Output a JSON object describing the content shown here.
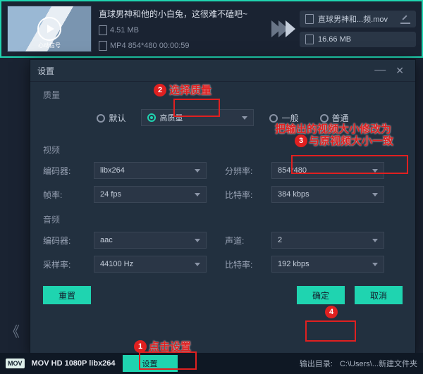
{
  "topbar": {
    "source_title": "直球男神和他的小白兔，这很难不磕吧~",
    "thumb_sub": "心动信号",
    "source_size": "4.51 MB",
    "source_format": "MP4 854*480 00:00:59",
    "output_name": "直球男神和...频.mov",
    "output_size": "16.66 MB"
  },
  "dialog": {
    "title": "设置",
    "sec_quality": "质量",
    "quality": {
      "default": "默认",
      "high": "高质量",
      "medium": "一般",
      "normal": "普通"
    },
    "sec_video": "视频",
    "video": {
      "encoder_lbl": "编码器:",
      "encoder_val": "libx264",
      "res_lbl": "分辨率:",
      "res_val": "854*480",
      "fps_lbl": "帧率:",
      "fps_val": "24 fps",
      "bitrate_lbl": "比特率:",
      "bitrate_val": "384 kbps"
    },
    "sec_audio": "音频",
    "audio": {
      "encoder_lbl": "编码器:",
      "encoder_val": "aac",
      "channel_lbl": "声道:",
      "channel_val": "2",
      "sample_lbl": "采样率:",
      "sample_val": "44100 Hz",
      "bitrate_lbl": "比特率:",
      "bitrate_val": "192 kbps"
    },
    "reset": "重置",
    "ok": "确定",
    "cancel": "取消"
  },
  "bottom": {
    "badge": "MOV",
    "format": "MOV HD 1080P libx264",
    "settings": "设置",
    "outdir_lbl": "输出目录:",
    "outdir": "C:\\Users\\...新建文件夹"
  },
  "annotations": {
    "n1": "1",
    "t1": "点击设置",
    "n2": "2",
    "t2": "选择质量",
    "n3": "3",
    "t3a": "把输出的视频大小修改为",
    "t3b": "与原视频大小一致",
    "n4": "4"
  }
}
